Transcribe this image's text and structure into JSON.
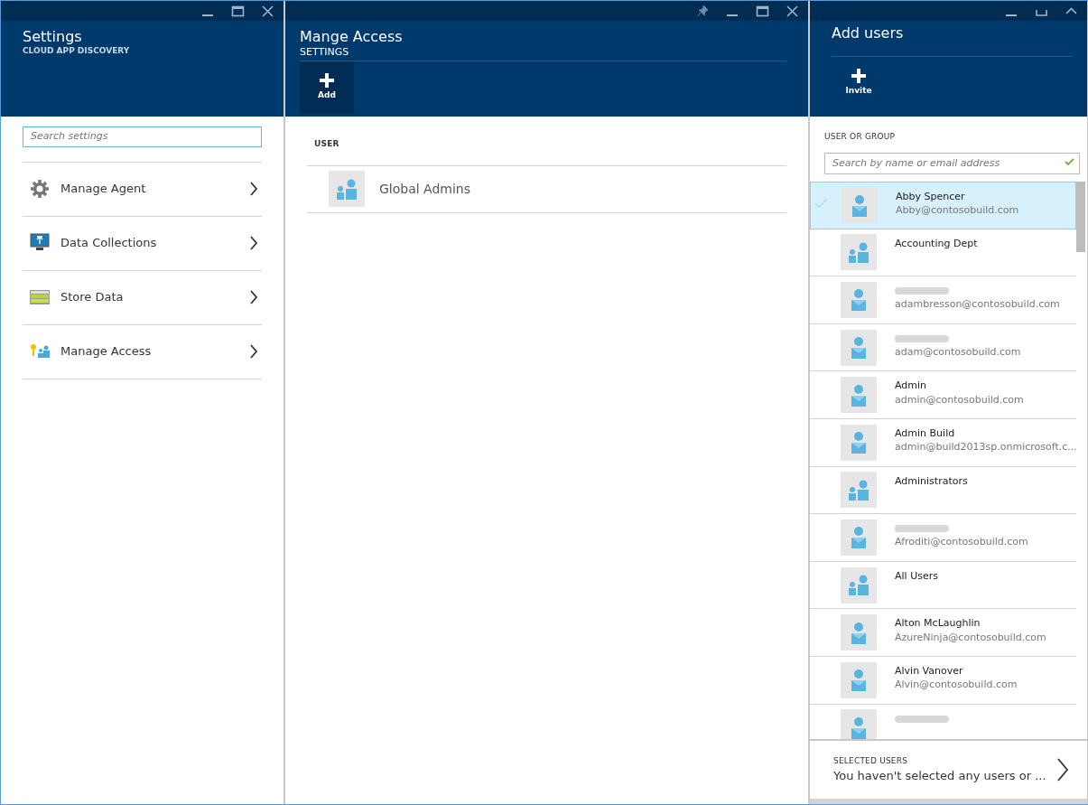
{
  "panels": [
    {
      "title": "Settings",
      "subtitle": "CLOUD APP DISCOVERY",
      "controls": [
        {
          "kind": "minimize"
        },
        {
          "kind": "maximize"
        },
        {
          "kind": "close"
        }
      ],
      "search": {
        "placeholder": "Search settings"
      },
      "items": [
        {
          "label": "Manage Agent",
          "kind": "gear"
        },
        {
          "label": "Data Collections",
          "kind": "monitor"
        },
        {
          "label": "Store Data",
          "kind": "storage"
        },
        {
          "label": "Manage Access",
          "kind": "access"
        }
      ]
    },
    {
      "title": "Mange Access",
      "subtitle": "SETTINGS",
      "controls": [
        {
          "kind": "pin"
        },
        {
          "kind": "minimize"
        },
        {
          "kind": "maximize"
        },
        {
          "kind": "close"
        }
      ],
      "commands": [
        {
          "label": "Add",
          "selected": true
        }
      ],
      "column": "USER",
      "rows": [
        {
          "name": "Global Admins",
          "kind": "group"
        }
      ]
    },
    {
      "title": "Add users",
      "controls": [
        {
          "kind": "minimize"
        },
        {
          "kind": "restore"
        },
        {
          "kind": "collapse"
        }
      ],
      "commands": [
        {
          "label": "Invite",
          "selected": false
        }
      ],
      "section_label": "USER OR GROUP",
      "search": {
        "placeholder": "Search by name or email address"
      },
      "users": [
        {
          "name": "Abby Spencer",
          "email": "Abby@contosobuild.com",
          "kind": "user",
          "selected": true,
          "blurred": false
        },
        {
          "name": "Accounting Dept",
          "kind": "group",
          "selected": false,
          "blurred": false
        },
        {
          "email": "adambresson@contosobuild.com",
          "kind": "user",
          "selected": false,
          "blurred": true
        },
        {
          "email": "adam@contosobuild.com",
          "kind": "user",
          "selected": false,
          "blurred": true
        },
        {
          "name": "Admin",
          "email": "admin@contosobuild.com",
          "kind": "user",
          "selected": false,
          "blurred": false
        },
        {
          "name": "Admin Build",
          "email": "admin@build2013sp.onmicrosoft.c...",
          "kind": "user",
          "selected": false,
          "blurred": false
        },
        {
          "name": "Administrators",
          "kind": "group",
          "selected": false,
          "blurred": false
        },
        {
          "email": "Afroditi@contosobuild.com",
          "kind": "user",
          "selected": false,
          "blurred": true
        },
        {
          "name": "All Users",
          "kind": "group",
          "selected": false,
          "blurred": false
        },
        {
          "name": "Alton McLaughlin",
          "email": "AzureNinja@contosobuild.com",
          "kind": "user",
          "selected": false,
          "blurred": false
        },
        {
          "name": "Alvin Vanover",
          "email": "Alvin@contosobuild.com",
          "kind": "user",
          "selected": false,
          "blurred": false
        },
        {
          "kind": "user",
          "selected": false,
          "blurred": true
        }
      ],
      "footer": {
        "label": "SELECTED USERS",
        "text": "You haven't selected any users or ..."
      }
    }
  ]
}
